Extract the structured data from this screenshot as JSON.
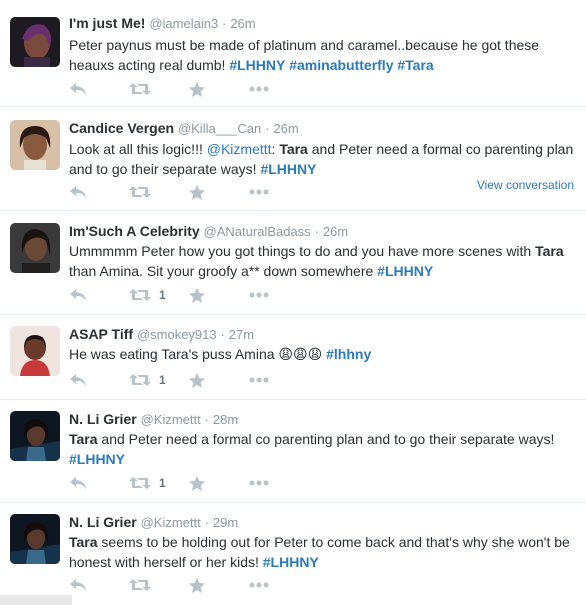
{
  "tweets": [
    {
      "name": "I'm just Me!",
      "handle": "@iamelain3",
      "time": "26m",
      "text_a": "Peter paynus must be made of platinum and caramel..because he got  these heauxs acting real dumb! ",
      "tag1": "#LHHNY",
      "tag2": "#aminabutterfly",
      "tag3": "#Tara",
      "retweets": "",
      "avatar_color": "#5a3a54"
    },
    {
      "name": "Candice Vergen",
      "handle": "@Killa___Can",
      "time": "26m",
      "text_a": "Look at all this logic!!! ",
      "mention": "@Kizmettt",
      "bold_word": "Tara",
      "text_b": " and Peter need a formal co parenting plan and to go their separate ways! ",
      "tag1": "#LHHNY",
      "view_conversation": "View conversation",
      "retweets": "",
      "avatar_color": "#7a4a34"
    },
    {
      "name": "Im'Such A Celebrity",
      "handle": "@ANaturalBadass",
      "time": "26m",
      "text_a": "Ummmmm Peter how you got things to do and you have more scenes with ",
      "bold_word": "Tara",
      "text_b": " than Amina. Sit your groofy a** down somewhere ",
      "tag1": "#LHHNY",
      "retweets": "1",
      "avatar_color": "#4a3628"
    },
    {
      "name": "ASAP Tiff",
      "handle": "@smokey913",
      "time": "27m",
      "text_a": "He was eating Tara's puss Amina ",
      "emoji": "😩😩😩",
      "tag1": "#lhhny",
      "retweets": "1",
      "avatar_color": "#8a3a3a"
    },
    {
      "name": "N. Li Grier",
      "handle": "@Kizmettt",
      "time": "28m",
      "bold_word": "Tara",
      "text_b": " and Peter need a formal co parenting plan and to go their separate ways! ",
      "tag1": "#LHHNY",
      "retweets": "1",
      "avatar_color": "#2b3a4a"
    },
    {
      "name": "N. Li Grier",
      "handle": "@Kizmettt",
      "time": "29m",
      "bold_word": "Tara",
      "text_b": " seems to be holding out for Peter to come back and that's why she won't be honest with herself or her kids! ",
      "tag1": "#LHHNY",
      "retweets": "",
      "avatar_color": "#2b3a4a"
    }
  ],
  "separator": "·",
  "icons": [
    "reply-icon",
    "retweet-icon",
    "favorite-icon",
    "more-icon"
  ],
  "colors": {
    "link": "#2b7bb9",
    "meta": "#8899a6",
    "action_icon": "#b7c3cc",
    "divider": "#e6ecf0"
  }
}
